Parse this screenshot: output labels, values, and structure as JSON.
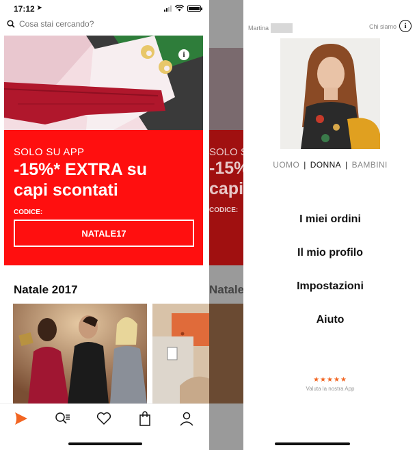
{
  "status": {
    "time": "17:12"
  },
  "search": {
    "placeholder": "Cosa stai cercando?"
  },
  "banner": {
    "tagline": "SOLO SU APP",
    "headline_line1": "-15%* EXTRA su",
    "headline_line2": "capi scontati",
    "code_label": "CODICE:",
    "code": "NATALE17",
    "color": "#ff0f0f"
  },
  "section": {
    "title": "Natale 2017"
  },
  "tabbar": {
    "items": [
      "home-logo-icon",
      "search-list-icon",
      "heart-icon",
      "shopping-bag-icon",
      "profile-icon"
    ],
    "accent": "#f26522"
  },
  "menu_screen": {
    "user_name": "Martina",
    "about_label": "Chi siamo",
    "gender": {
      "options": [
        "UOMO",
        "DONNA",
        "BAMBINI"
      ],
      "selected": "DONNA",
      "sep": "|"
    },
    "items": [
      "I miei ordini",
      "Il mio profilo",
      "Impostazioni",
      "Aiuto"
    ],
    "rating": {
      "stars": "★★★★★",
      "label": "Valuta la nostra App"
    }
  },
  "peek": {
    "solo": "SOLO SU",
    "headline1": "-15%",
    "headline2": "capi",
    "codice": "CODICE:",
    "title": "Natale"
  }
}
